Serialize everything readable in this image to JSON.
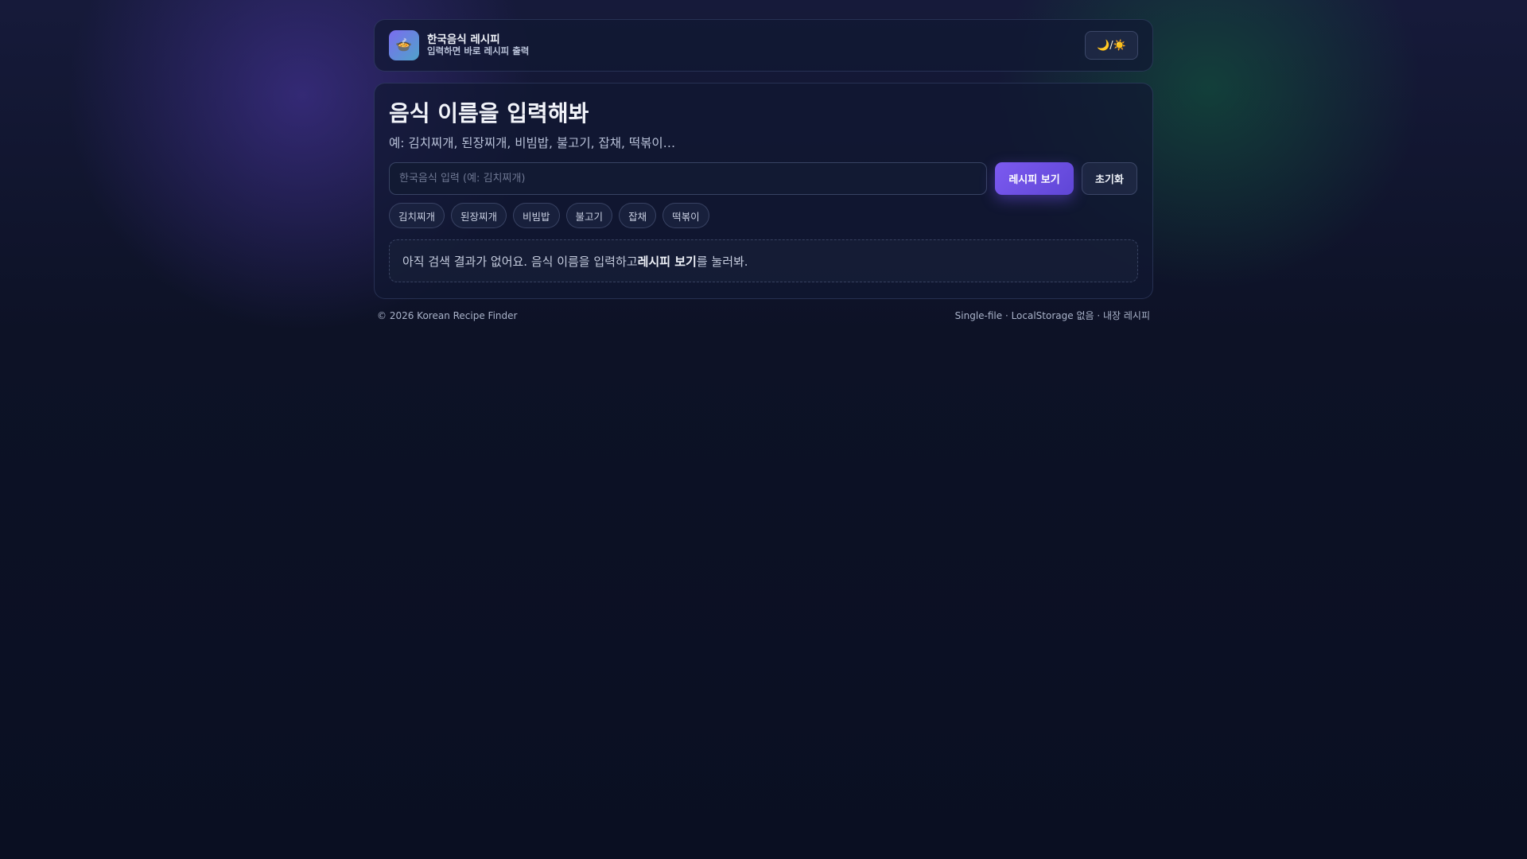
{
  "header": {
    "logo_icon": "🍲",
    "title": "한국음식 레시피",
    "subtitle": "입력하면 바로 레시피 출력",
    "theme_toggle_label": "🌙/☀️"
  },
  "main": {
    "title": "음식 이름을 입력해봐",
    "examples": "예: 김치찌개, 된장찌개, 비빔밥, 불고기, 잡채, 떡볶이…",
    "search": {
      "placeholder": "한국음식 입력 (예: 김치찌개)",
      "value": ""
    },
    "recipe_button_label": "레시피 보기",
    "reset_button_label": "초기화",
    "chips": [
      "김치찌개",
      "된장찌개",
      "비빔밥",
      "불고기",
      "잡채",
      "떡볶이"
    ],
    "empty_state": {
      "before": "아직 검색 결과가 없어요. 음식 이름을 입력하고 ",
      "emphasis": "레시피 보기",
      "after": "를 눌러봐."
    }
  },
  "footer": {
    "copyright": "© 2026 Korean Recipe Finder",
    "meta": "Single-file · LocalStorage 없음 · 내장 레시피"
  },
  "colors": {
    "accent": "#6f50e6",
    "background": "#0b1024",
    "card": "#121a35"
  }
}
